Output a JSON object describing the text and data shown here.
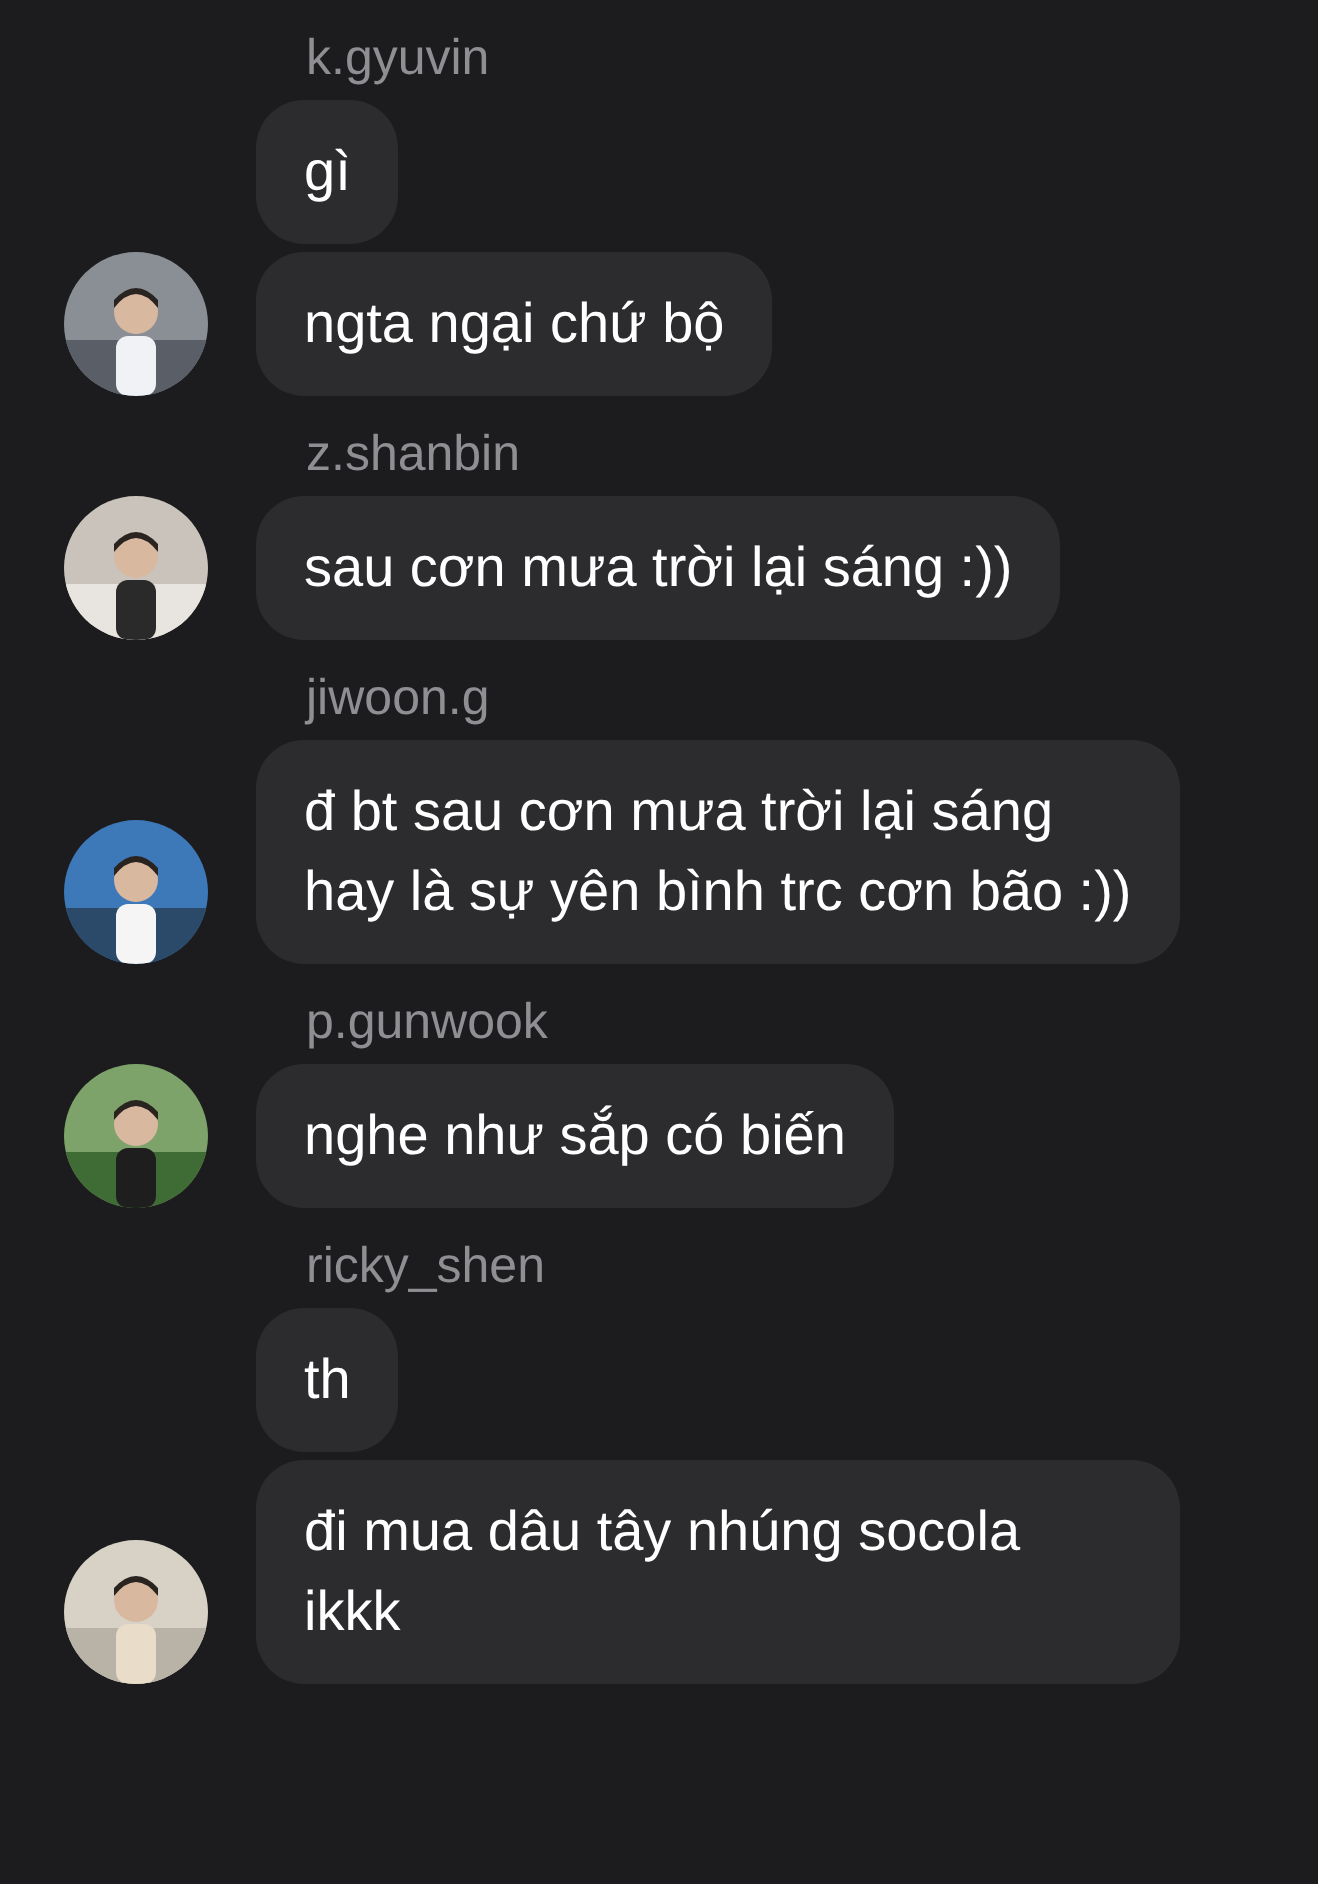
{
  "groups": [
    {
      "sender": "k.gyuvin",
      "messages": [
        "gì",
        "ngta ngại chứ bộ"
      ]
    },
    {
      "sender": "z.shanbin",
      "messages": [
        "sau cơn mưa trời lại sáng :))"
      ]
    },
    {
      "sender": "jiwoon.g",
      "messages": [
        "đ bt sau cơn mưa trời lại sáng hay là sự yên bình trc cơn bão :))"
      ]
    },
    {
      "sender": "p.gunwook",
      "messages": [
        "nghe như sắp có biến"
      ]
    },
    {
      "sender": "ricky_shen",
      "messages": [
        "th",
        "đi mua dâu tây nhúng socola ikkk"
      ]
    }
  ]
}
